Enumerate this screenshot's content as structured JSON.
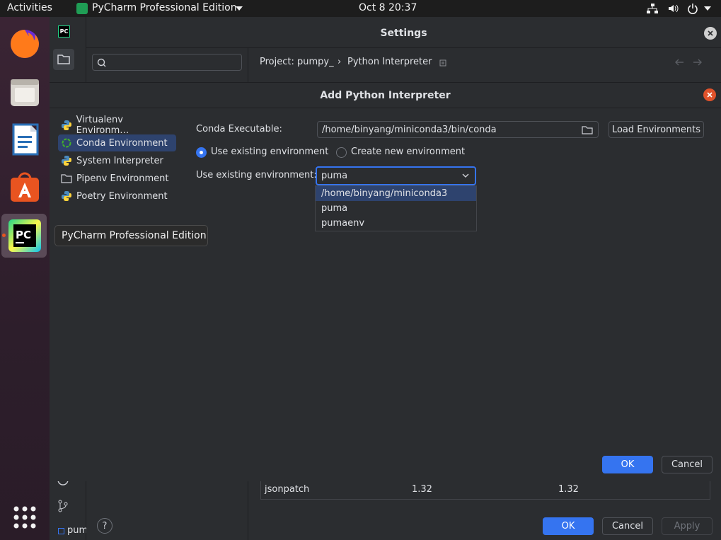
{
  "topbar": {
    "activities": "Activities",
    "app_menu": "PyCharm Professional Edition",
    "clock": "Oct 8  20:37"
  },
  "dock": {
    "tooltip": "PyCharm Professional Edition",
    "icons": [
      "firefox-icon",
      "files-icon",
      "writer-icon",
      "software-icon",
      "pycharm-icon",
      "app-grid-icon"
    ]
  },
  "settings": {
    "title": "Settings",
    "search_placeholder": "",
    "breadcrumb_project": "Project: pumpy_",
    "breadcrumb_sep": "›",
    "breadcrumb_page": "Python Interpreter",
    "package_row": {
      "name": "jsonpatch",
      "version": "1.32",
      "latest": "1.32"
    },
    "ok": "OK",
    "cancel": "Cancel",
    "apply": "Apply",
    "help": "?",
    "project_tab": "pum"
  },
  "dialog": {
    "title": "Add Python Interpreter",
    "nav": [
      {
        "label": "Virtualenv Environm…"
      },
      {
        "label": "Conda Environment"
      },
      {
        "label": "System Interpreter"
      },
      {
        "label": "Pipenv Environment"
      },
      {
        "label": "Poetry Environment"
      }
    ],
    "conda_exec_label": "Conda Executable:",
    "conda_exec_value": "/home/binyang/miniconda3/bin/conda",
    "load_envs": "Load Environments",
    "radio_existing": "Use existing environment",
    "radio_new": "Create new environment",
    "existing_env_label": "Use existing environment:",
    "existing_env_value": "puma",
    "options": [
      "/home/binyang/miniconda3",
      "puma",
      "pumaenv"
    ],
    "ok": "OK",
    "cancel": "Cancel"
  },
  "colors": {
    "accent": "#3574f0",
    "selection": "#2e436e",
    "close": "#e0522b"
  }
}
